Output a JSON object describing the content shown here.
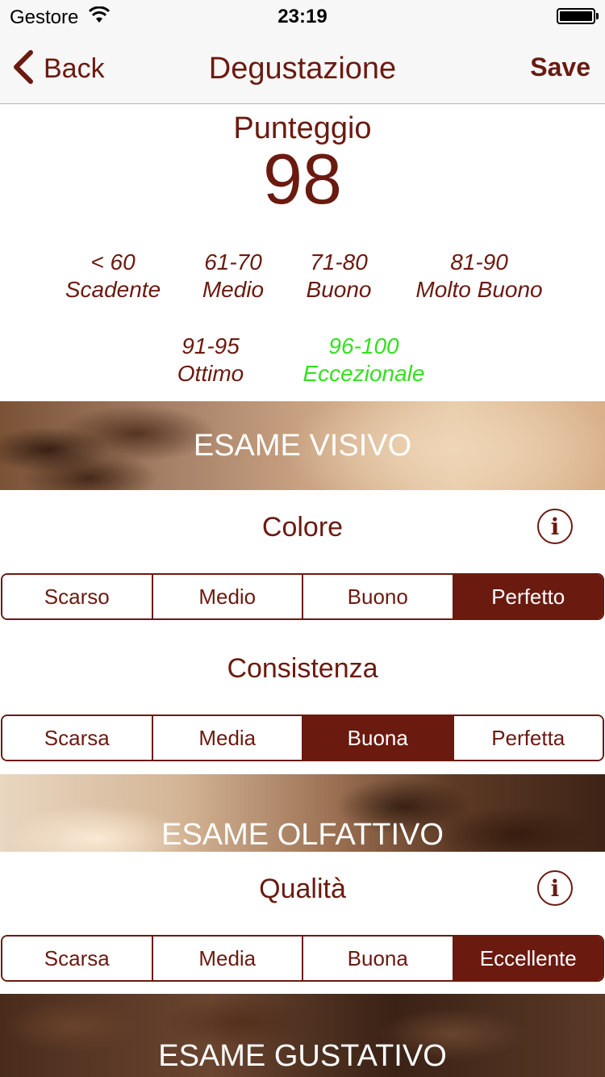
{
  "status_bar": {
    "carrier": "Gestore",
    "time": "23:19"
  },
  "nav": {
    "back_label": "Back",
    "title": "Degustazione",
    "save_label": "Save"
  },
  "score": {
    "label": "Punteggio",
    "value": "98",
    "legend": [
      {
        "range": "< 60",
        "label": "Scadente",
        "active": false
      },
      {
        "range": "61-70",
        "label": "Medio",
        "active": false
      },
      {
        "range": "71-80",
        "label": "Buono",
        "active": false
      },
      {
        "range": "81-90",
        "label": "Molto Buono",
        "active": false
      },
      {
        "range": "91-95",
        "label": "Ottimo",
        "active": false
      },
      {
        "range": "96-100",
        "label": "Eccezionale",
        "active": true
      }
    ]
  },
  "sections": {
    "visivo": {
      "title": "ESAME VISIVO",
      "colore": {
        "label": "Colore",
        "options": [
          "Scarso",
          "Medio",
          "Buono",
          "Perfetto"
        ],
        "selected": "Perfetto"
      },
      "consistenza": {
        "label": "Consistenza",
        "options": [
          "Scarsa",
          "Media",
          "Buona",
          "Perfetta"
        ],
        "selected": "Buona"
      }
    },
    "olfattivo": {
      "title": "ESAME OLFATTIVO",
      "qualita": {
        "label": "Qualità",
        "options": [
          "Scarsa",
          "Media",
          "Buona",
          "Eccellente"
        ],
        "selected": "Eccellente"
      }
    },
    "gustativo": {
      "title": "ESAME GUSTATIVO"
    }
  },
  "colors": {
    "accent": "#6b1a10",
    "highlight": "#33e01f"
  },
  "icons": {
    "back": "chevron-left-icon",
    "info": "info-icon",
    "wifi": "wifi-icon",
    "battery": "battery-icon"
  }
}
